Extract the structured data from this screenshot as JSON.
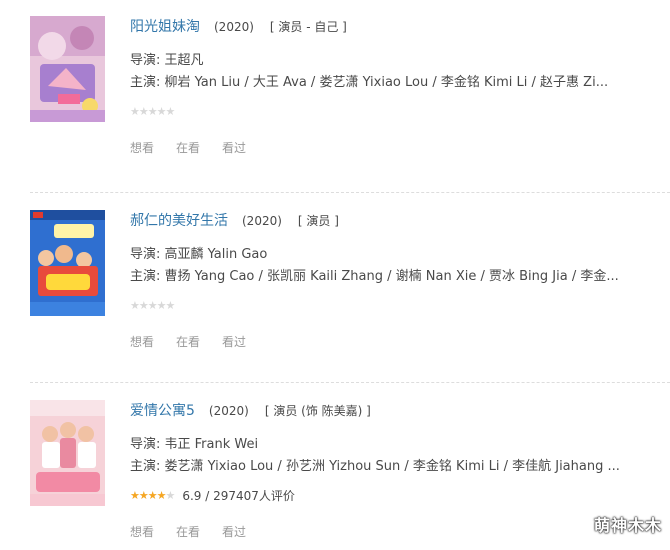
{
  "colors": {
    "link": "#3377aa",
    "text": "#494949",
    "muted": "#999999",
    "star_on": "#f5a623",
    "star_off": "#d8d8d8",
    "divider": "#dddddd"
  },
  "movies": [
    {
      "title": "阳光姐妹淘",
      "year": "(2020)",
      "role": "[ 演员 - 自己 ]",
      "director": "导演: 王超凡",
      "cast": "主演: 柳岩 Yan Liu / 大王 Ava / 娄艺潇 Yixiao Lou / 李金铭 Kimi Li / 赵子惠 Zi...",
      "rating": null,
      "rating_text": "",
      "actions": [
        "想看",
        "在看",
        "看过"
      ]
    },
    {
      "title": "郝仁的美好生活",
      "year": "(2020)",
      "role": "[ 演员 ]",
      "director": "导演: 高亚麟 Yalin Gao",
      "cast": "主演: 曹扬 Yang Cao / 张凯丽 Kaili Zhang / 谢楠 Nan Xie / 贾冰 Bing Jia / 李金...",
      "rating": null,
      "rating_text": "",
      "actions": [
        "想看",
        "在看",
        "看过"
      ]
    },
    {
      "title": "爱情公寓5",
      "year": "(2020)",
      "role": "[ 演员 (饰 陈美嘉) ]",
      "director": "导演: 韦正 Frank Wei",
      "cast": "主演: 娄艺潇 Yixiao Lou / 孙艺洲 Yizhou Sun / 李金铭 Kimi Li / 李佳航 Jiahang ...",
      "rating": 3.5,
      "rating_text": "6.9 / 297407人评价",
      "actions": [
        "想看",
        "在看",
        "看过"
      ]
    }
  ],
  "watermark": "萌神木木"
}
